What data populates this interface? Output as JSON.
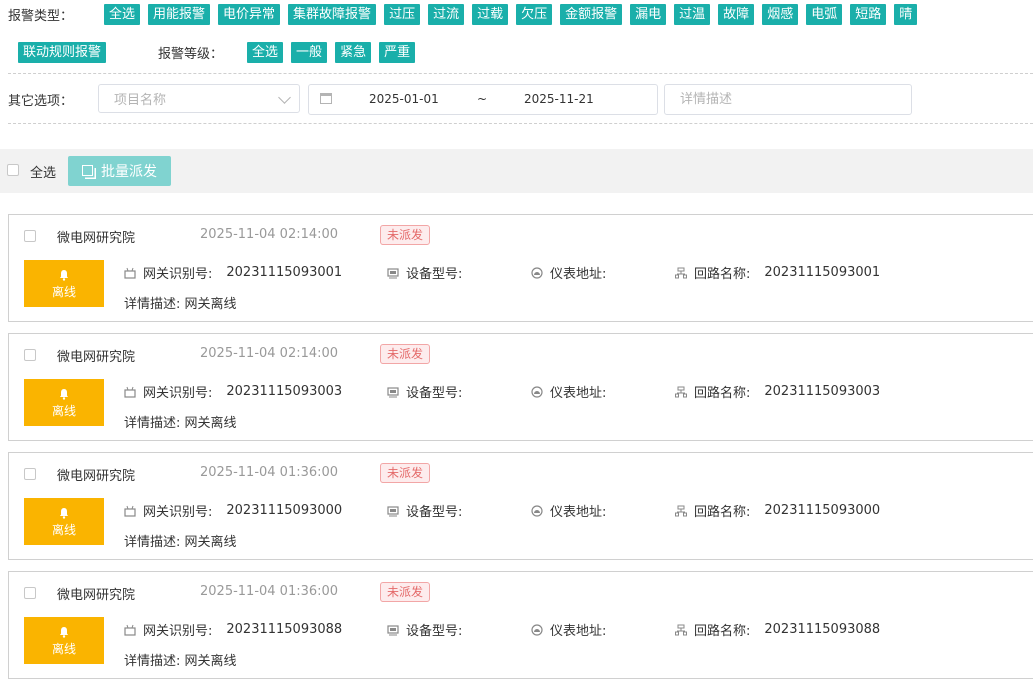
{
  "filters": {
    "alarm_type_label": "报警类型：",
    "alarm_types": [
      "全选",
      "用能报警",
      "电价异常",
      "集群故障报警",
      "过压",
      "过流",
      "过载",
      "欠压",
      "金额报警",
      "漏电",
      "过温",
      "故障",
      "烟感",
      "电弧",
      "短路",
      "晴"
    ],
    "linkage_tag": "联动规则报警",
    "alarm_level_label": "报警等级：",
    "alarm_levels": [
      "全选",
      "一般",
      "紧急",
      "严重"
    ],
    "other_label": "其它选项：",
    "project_placeholder": "项目名称",
    "date_start": "2025-01-01",
    "date_sep": "~",
    "date_end": "2025-11-21",
    "detail_placeholder": "详情描述"
  },
  "bulk": {
    "select_all_label": "全选",
    "dispatch_label": "批量派发"
  },
  "labels": {
    "gateway_id": "网关识别号:",
    "device_model": "设备型号:",
    "meter_address": "仪表地址:",
    "circuit_name": "回路名称:",
    "detail_prefix": "详情描述:"
  },
  "colors": {
    "tag_bg": "#1aafaa",
    "offline_badge": "#fab400",
    "status_text": "#e46a6a",
    "dispatch_btn": "#80d3d0"
  },
  "alarms": [
    {
      "project": "微电网研究院",
      "time": "2025-11-04 02:14:00",
      "status": "未派发",
      "badge": "离线",
      "gateway_id": "20231115093001",
      "device_model": "",
      "meter_address": "",
      "circuit_name": "20231115093001",
      "detail": "网关离线"
    },
    {
      "project": "微电网研究院",
      "time": "2025-11-04 02:14:00",
      "status": "未派发",
      "badge": "离线",
      "gateway_id": "20231115093003",
      "device_model": "",
      "meter_address": "",
      "circuit_name": "20231115093003",
      "detail": "网关离线"
    },
    {
      "project": "微电网研究院",
      "time": "2025-11-04 01:36:00",
      "status": "未派发",
      "badge": "离线",
      "gateway_id": "20231115093000",
      "device_model": "",
      "meter_address": "",
      "circuit_name": "20231115093000",
      "detail": "网关离线"
    },
    {
      "project": "微电网研究院",
      "time": "2025-11-04 01:36:00",
      "status": "未派发",
      "badge": "离线",
      "gateway_id": "20231115093088",
      "device_model": "",
      "meter_address": "",
      "circuit_name": "20231115093088",
      "detail": "网关离线"
    }
  ]
}
